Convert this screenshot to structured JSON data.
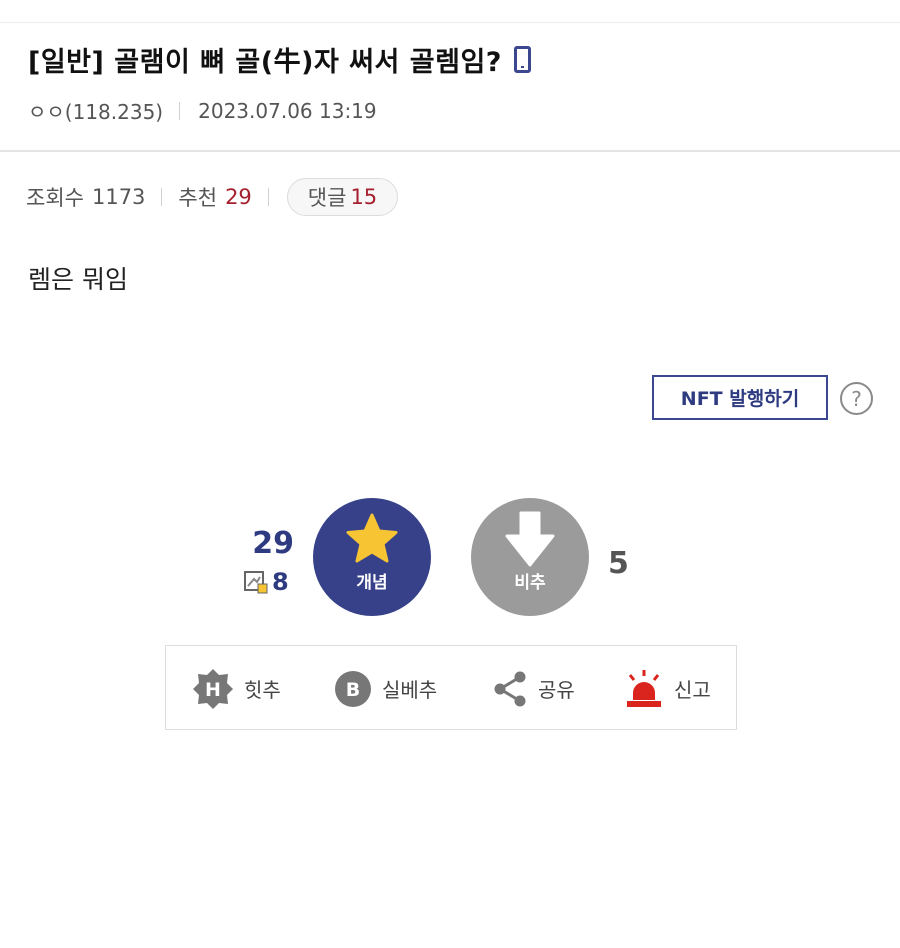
{
  "post": {
    "title": "[일반] 골램이 뼈 골(牛)자 써서 골렘임?",
    "author": "ㅇㅇ(118.235)",
    "date": "2023.07.06 13:19",
    "body": "렘은 뭐임"
  },
  "stats": {
    "views_label": "조회수",
    "views": "1173",
    "recommend_label": "추천",
    "recommend": "29",
    "comments_label": "댓글",
    "comments": "15"
  },
  "nft": {
    "button_label": "NFT 발행하기",
    "help_glyph": "?"
  },
  "vote": {
    "up_count": "29",
    "fix_count": "8",
    "up_label": "개념",
    "down_label": "비추",
    "down_count": "5"
  },
  "actions": {
    "hit_label": "힛추",
    "best_label": "실베추",
    "share_label": "공유",
    "report_label": "신고",
    "hit_glyph": "H",
    "best_glyph": "B"
  },
  "colors": {
    "brand_navy": "#36418a",
    "recommend_red": "#a5202e",
    "star_yellow": "#f7c433",
    "report_red": "#d9251d",
    "down_gray": "#9b9b9b"
  },
  "icons": [
    "phone-icon",
    "help-icon",
    "star-icon",
    "down-arrow-icon",
    "hit-badge-icon",
    "best-badge-icon",
    "share-icon",
    "siren-icon",
    "fix-icon"
  ]
}
